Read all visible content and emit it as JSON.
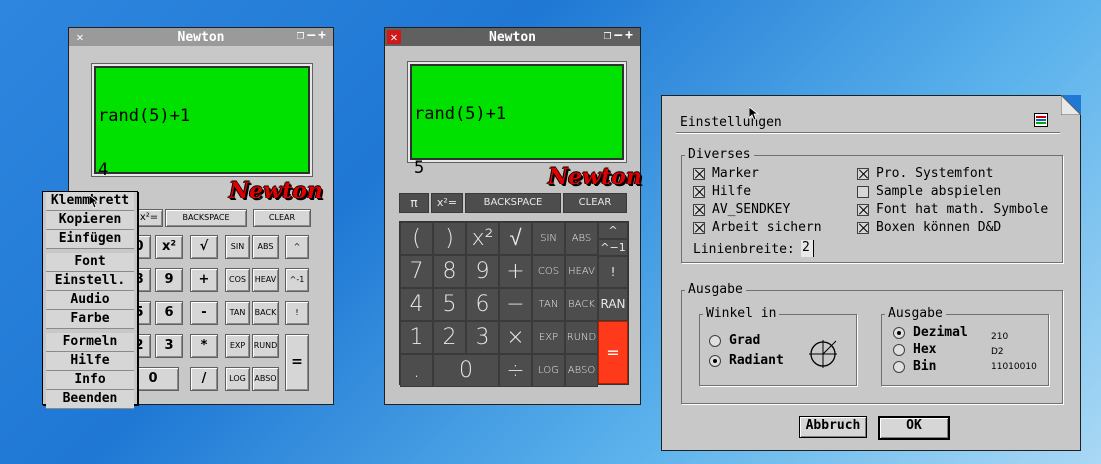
{
  "win1": {
    "title": "Newton",
    "display_line1": "rand(5)+1",
    "display_line2": "4",
    "logo": "Newton",
    "top_buttons": [
      "x²=",
      "BACKSPACE",
      "CLEAR"
    ],
    "buttons": [
      [
        "0",
        "x²",
        "√",
        "SIN",
        "ABS",
        "^"
      ],
      [
        "8",
        "9",
        "+",
        "COS",
        "HEAV",
        "^-1"
      ],
      [
        "5",
        "6",
        "-",
        "TAN",
        "BACK",
        "!"
      ],
      [
        "2",
        "3",
        "*",
        "EXP",
        "RUND",
        "RAN"
      ],
      [
        "",
        "0",
        "/",
        "LOG",
        "ABSO",
        "="
      ]
    ]
  },
  "menu": {
    "items": [
      "Klemmbrett",
      "Kopieren",
      "Einfügen",
      "Font",
      "Einstell.",
      "Audio",
      "Farbe",
      "Formeln",
      "Hilfe",
      "Info",
      "Beenden"
    ]
  },
  "win2": {
    "title": "Newton",
    "display_line1": "rand(5)+1",
    "display_line2": "5",
    "logo": "Newton",
    "top_buttons": [
      "π",
      "x²=",
      "BACKSPACE",
      "CLEAR"
    ],
    "rows": [
      [
        "(",
        ")",
        "x²",
        "√",
        "SIN",
        "ABS"
      ],
      [
        "7",
        "8",
        "9",
        "+",
        "COS",
        "HEAV"
      ],
      [
        "4",
        "5",
        "6",
        "−",
        "TAN",
        "BACK"
      ],
      [
        "1",
        "2",
        "3",
        "×",
        "EXP",
        "RUND"
      ],
      [
        ".",
        "0",
        "÷",
        "LOG",
        "ABSO"
      ]
    ],
    "side": [
      "^",
      "^−1",
      "!",
      "RAN",
      "="
    ],
    "equals_color": "#ff3a1a"
  },
  "dialog": {
    "title": "Einstellungen",
    "diverses_label": "Diverses",
    "checks_left": [
      {
        "label": "Marker",
        "on": true
      },
      {
        "label": "Hilfe",
        "on": true
      },
      {
        "label": "AV_SENDKEY",
        "on": true
      },
      {
        "label": "Arbeit sichern",
        "on": true
      }
    ],
    "checks_right": [
      {
        "label": "Pro. Systemfont",
        "on": true
      },
      {
        "label": "Sample abspielen",
        "on": false
      },
      {
        "label": "Font hat math. Symbole",
        "on": true
      },
      {
        "label": "Boxen können D&D",
        "on": true
      }
    ],
    "linienbreite_label": "Linienbreite:",
    "linienbreite_value": "2",
    "ausgabe_label": "Ausgabe",
    "winkel_label": "Winkel in",
    "grad": "Grad",
    "radiant": "Radiant",
    "ausgabe_inner_label": "Ausgabe",
    "dezimal": "Dezimal",
    "hex": "Hex",
    "bin": "Bin",
    "dezimal_val": "210",
    "hex_val": "D2",
    "bin_val": "11010010",
    "abbruch": "Abbruch",
    "ok": "OK"
  }
}
